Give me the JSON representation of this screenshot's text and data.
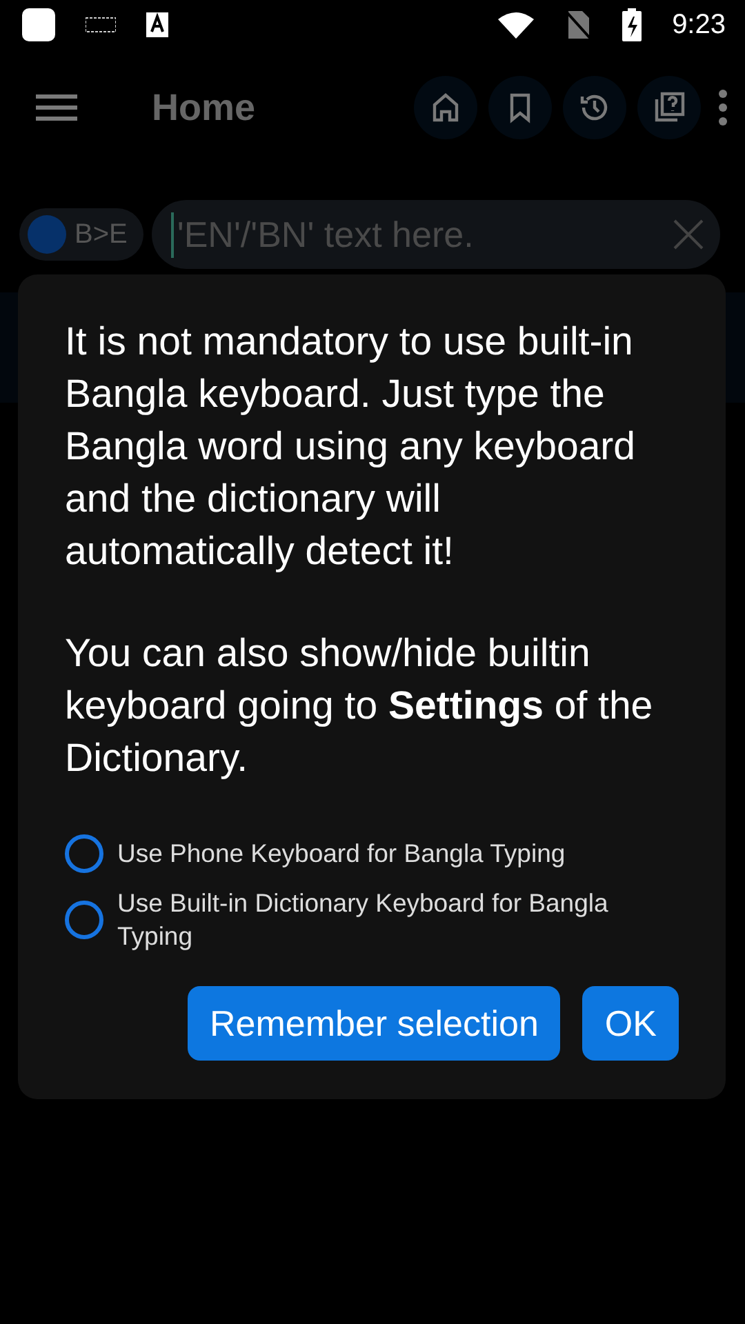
{
  "status_bar": {
    "time": "9:23"
  },
  "app_bar": {
    "title": "Home"
  },
  "search": {
    "mode": "B>E",
    "placeholder": "'EN'/'BN' text here."
  },
  "dialog": {
    "paragraphs": [
      "It is not mandatory to use built-in Bangla keyboard. Just type the Bangla word using any keyboard and the dictionary will automatically detect it!",
      "You can also show/hide builtin keyboard going to **Settings** of the Dictionary."
    ],
    "options": [
      {
        "label": "Use Phone Keyboard for Bangla Typing",
        "selected": false
      },
      {
        "label": "Use Built-in Dictionary Keyboard for Bangla Typing",
        "selected": false
      }
    ],
    "buttons": [
      "Remember selection",
      "OK"
    ]
  }
}
